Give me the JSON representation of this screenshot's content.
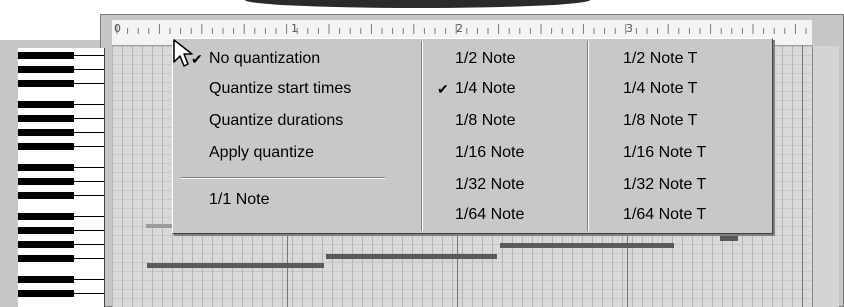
{
  "ruler": {
    "numbers": [
      "0",
      "1",
      "2",
      "3"
    ]
  },
  "menu": {
    "quantize_options": [
      {
        "label": "No quantization",
        "checked": true
      },
      {
        "label": "Quantize start times",
        "checked": false
      },
      {
        "label": "Quantize durations",
        "checked": false
      },
      {
        "label": "Apply quantize",
        "checked": false
      }
    ],
    "whole_note": "1/1 Note",
    "notes": [
      {
        "label": "1/2 Note",
        "checked": false
      },
      {
        "label": "1/4 Note",
        "checked": true
      },
      {
        "label": "1/8 Note",
        "checked": false
      },
      {
        "label": "1/16 Note",
        "checked": false
      },
      {
        "label": "1/32 Note",
        "checked": false
      },
      {
        "label": "1/64 Note",
        "checked": false
      }
    ],
    "triplets": [
      {
        "label": "1/2 Note T"
      },
      {
        "label": "1/4 Note T"
      },
      {
        "label": "1/8 Note T"
      },
      {
        "label": "1/16 Note T"
      },
      {
        "label": "1/32 Note T"
      },
      {
        "label": "1/64 Note T"
      }
    ]
  },
  "colors": {
    "menu_bg": "#c8c8c8",
    "note_bar": "#5a5a5a",
    "grid_bg": "#d9d9d9"
  }
}
